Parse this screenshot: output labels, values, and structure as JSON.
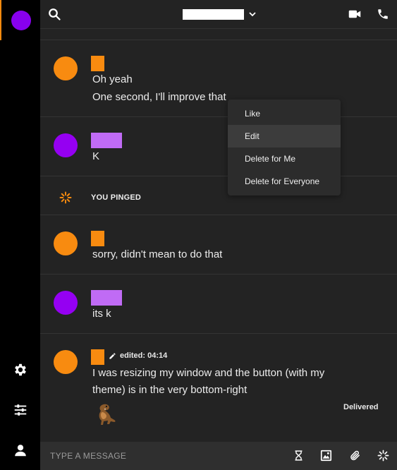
{
  "header": {
    "title": "",
    "accent_color": "#f58a0e"
  },
  "colors": {
    "orange": "#f88b10",
    "purple": "#9500f2",
    "purple_name": "#c06bf5",
    "background": "#232323"
  },
  "messages": [
    {
      "lines": [
        "Oh yeah",
        "One second, I'll improve that"
      ]
    },
    {
      "lines": [
        "K"
      ]
    },
    {
      "system": "YOU PINGED"
    },
    {
      "lines": [
        "sorry, didn't mean to do that"
      ]
    },
    {
      "lines": [
        "its k"
      ]
    },
    {
      "edited": "edited: 04:14",
      "lines": [
        "I was resizing my window and the button (with my",
        "theme) is in the very bottom-right"
      ],
      "status": "Delivered"
    }
  ],
  "context_menu": {
    "items": [
      "Like",
      "Edit",
      "Delete for Me",
      "Delete for Everyone"
    ],
    "highlighted": "Edit"
  },
  "composer": {
    "placeholder": "TYPE A MESSAGE"
  },
  "icons": [
    "search-icon",
    "chevron-down-icon",
    "video-call-icon",
    "phone-icon",
    "settings-icon",
    "sliders-icon",
    "profile-icon",
    "hourglass-icon",
    "image-icon",
    "paperclip-icon",
    "ping-icon",
    "pencil-icon",
    "dinosaur-sticker"
  ]
}
